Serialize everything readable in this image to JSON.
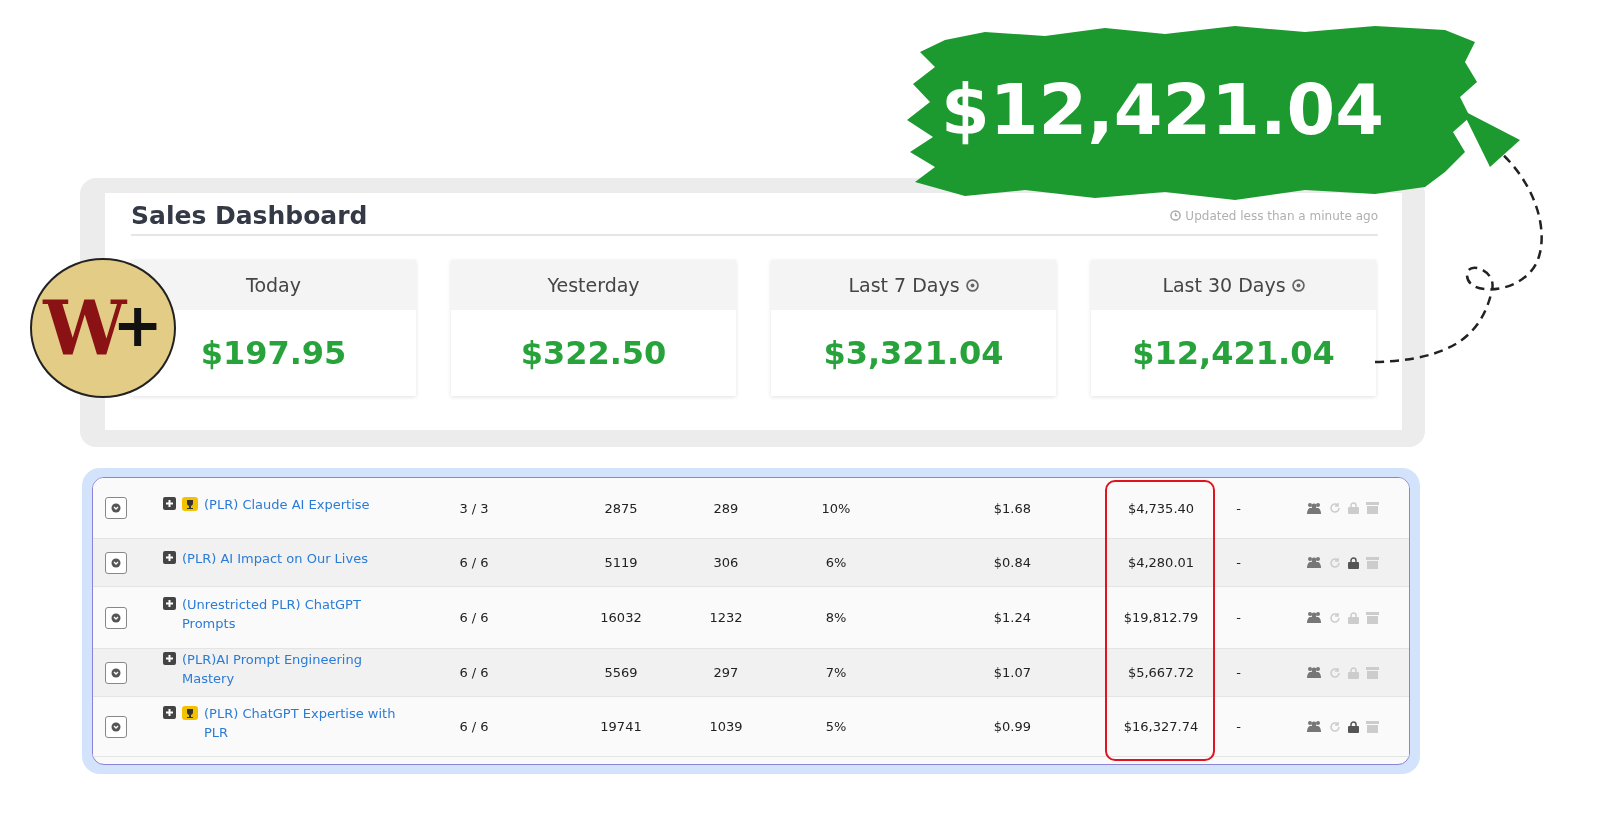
{
  "banner": {
    "amount": "$12,421.04"
  },
  "logo": {
    "letter": "W",
    "mark": "+"
  },
  "dashboard": {
    "title": "Sales Dashboard",
    "updated": "Updated less than a minute ago",
    "stats": [
      {
        "label": "Today",
        "value": "$197.95",
        "info": false
      },
      {
        "label": "Yesterday",
        "value": "$322.50",
        "info": false
      },
      {
        "label": "Last 7 Days",
        "value": "$3,321.04",
        "info": true
      },
      {
        "label": "Last 30 Days",
        "value": "$12,421.04",
        "info": true
      }
    ]
  },
  "products": [
    {
      "name": "(PLR) Claude AI Expertise",
      "trophy": true,
      "fraction": "3 / 3",
      "views": "2875",
      "sales": "289",
      "rate": "10%",
      "cost": "$1.68",
      "total": "$4,735.40",
      "dash": "-",
      "locked": false
    },
    {
      "name": "(PLR) AI Impact on Our Lives",
      "trophy": false,
      "fraction": "6 / 6",
      "views": "5119",
      "sales": "306",
      "rate": "6%",
      "cost": "$0.84",
      "total": "$4,280.01",
      "dash": "-",
      "locked": true
    },
    {
      "name": "(Unrestricted PLR) ChatGPT Prompts",
      "trophy": false,
      "fraction": "6 / 6",
      "views": "16032",
      "sales": "1232",
      "rate": "8%",
      "cost": "$1.24",
      "total": "$19,812.79",
      "dash": "-",
      "locked": false
    },
    {
      "name": "(PLR)AI Prompt Engineering Mastery",
      "trophy": false,
      "fraction": "6 / 6",
      "views": "5569",
      "sales": "297",
      "rate": "7%",
      "cost": "$1.07",
      "total": "$5,667.72",
      "dash": "-",
      "locked": false
    },
    {
      "name": "(PLR) ChatGPT Expertise with PLR",
      "trophy": true,
      "fraction": "6 / 6",
      "views": "19741",
      "sales": "1039",
      "rate": "5%",
      "cost": "$0.99",
      "total": "$16,327.74",
      "dash": "-",
      "locked": true
    }
  ]
}
